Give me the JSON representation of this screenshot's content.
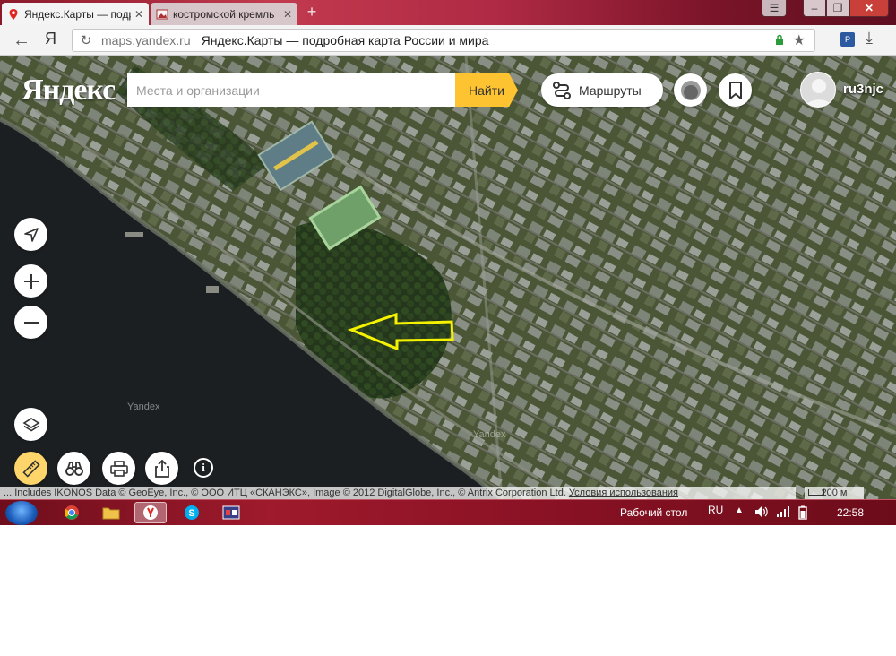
{
  "browser": {
    "tabs": [
      {
        "title": "Яндекс.Карты — подр",
        "active": true
      },
      {
        "title": "костромской кремль",
        "active": false
      }
    ],
    "new_tab": "+",
    "yandex_button": "Я",
    "url_host": "maps.yandex.ru",
    "page_title": "Яндекс.Карты — подробная карта России и мира"
  },
  "map": {
    "logo": "Яндекс",
    "search": {
      "placeholder": "Места и организации",
      "button": "Найти"
    },
    "routes_label": "Маршруты",
    "username": "ru3njc",
    "watermarks": [
      "Yandex",
      "Yandex"
    ],
    "copyright": "... Includes IKONOS Data © GeoEye, Inc., © ООО ИТЦ «СКАНЭКС», Image © 2012 DigitalGlobe, Inc., © Antrix Corporation Ltd. ",
    "terms_link": "Условия использования",
    "scale": "200 м",
    "info": "i"
  },
  "taskbar": {
    "desktop_label": "Рабочий стол",
    "language": "RU",
    "clock": "22:58"
  },
  "colors": {
    "search_button": "#fdc330",
    "annotation_arrow": "#f5f200",
    "river": "#1c1f22",
    "tab_strip": "#b02a45"
  }
}
